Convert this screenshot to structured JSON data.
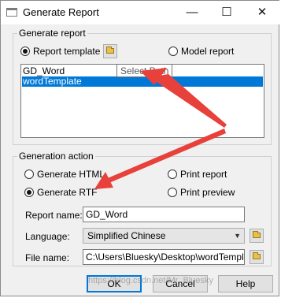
{
  "window": {
    "title": "Generate Report",
    "buttons": {
      "minimize": "—",
      "maximize": "☐",
      "close": "✕"
    }
  },
  "report_group": {
    "legend": "Generate report",
    "report_template_label": "Report template",
    "model_report_label": "Model report",
    "template_list": [
      "GD_Word",
      "wordTemplate"
    ],
    "selected_template": "wordTemplate",
    "tooltip": "Select Path"
  },
  "generation_action": {
    "legend": "Generation action",
    "generate_html_label": "Generate HTML",
    "generate_rtf_label": "Generate RTF",
    "print_report_label": "Print report",
    "print_preview_label": "Print preview",
    "selected": "Generate RTF"
  },
  "fields": {
    "report_name_label": "Report name:",
    "report_name_value": "GD_Word",
    "language_label": "Language:",
    "language_value": "Simplified Chinese",
    "file_name_label": "File name:",
    "file_name_value": "C:\\Users\\Bluesky\\Desktop\\wordTemplate"
  },
  "buttons": {
    "ok": "OK",
    "cancel": "Cancel",
    "help": "Help"
  },
  "watermark": "https://blog.csdn.net/Mr_Bluesky",
  "colors": {
    "selection": "#0078d7",
    "arrow": "#e8403a"
  }
}
